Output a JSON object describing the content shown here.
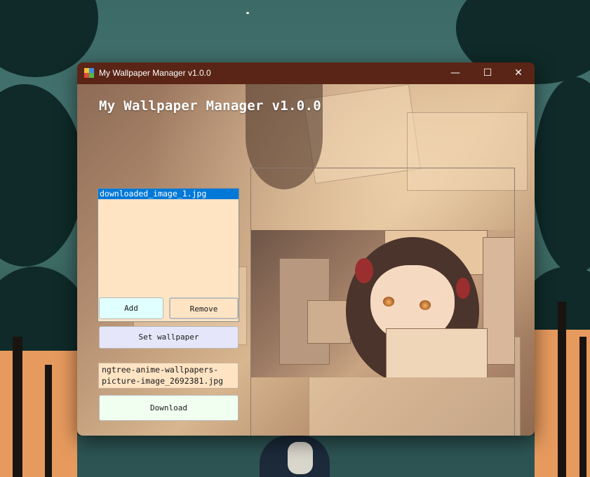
{
  "window": {
    "title": "My Wallpaper Manager v1.0.0",
    "controls": {
      "minimize": "—",
      "maximize": "☐",
      "close": "✕"
    }
  },
  "app": {
    "heading": "My Wallpaper Manager v1.0.0"
  },
  "file_list": {
    "items": [
      "downloaded_image_1.jpg"
    ],
    "selected_index": 0
  },
  "buttons": {
    "add": "Add",
    "remove": "Remove",
    "set_wallpaper": "Set wallpaper",
    "download": "Download"
  },
  "url_input": {
    "value": "ngtree-anime-wallpapers-\npicture-image_2692381.jpg"
  },
  "colors": {
    "titlebar": "#5a2516",
    "list_background": "#ffe4c4",
    "selection": "#0078d7",
    "add_button": "#e0ffff",
    "remove_button": "#ffe4c4",
    "set_wallpaper_button": "#e6e6fa",
    "download_button": "#f0fff0"
  },
  "icons": {
    "app": "app-window-icon",
    "minimize": "minimize-icon",
    "maximize": "maximize-icon",
    "close": "close-icon"
  }
}
